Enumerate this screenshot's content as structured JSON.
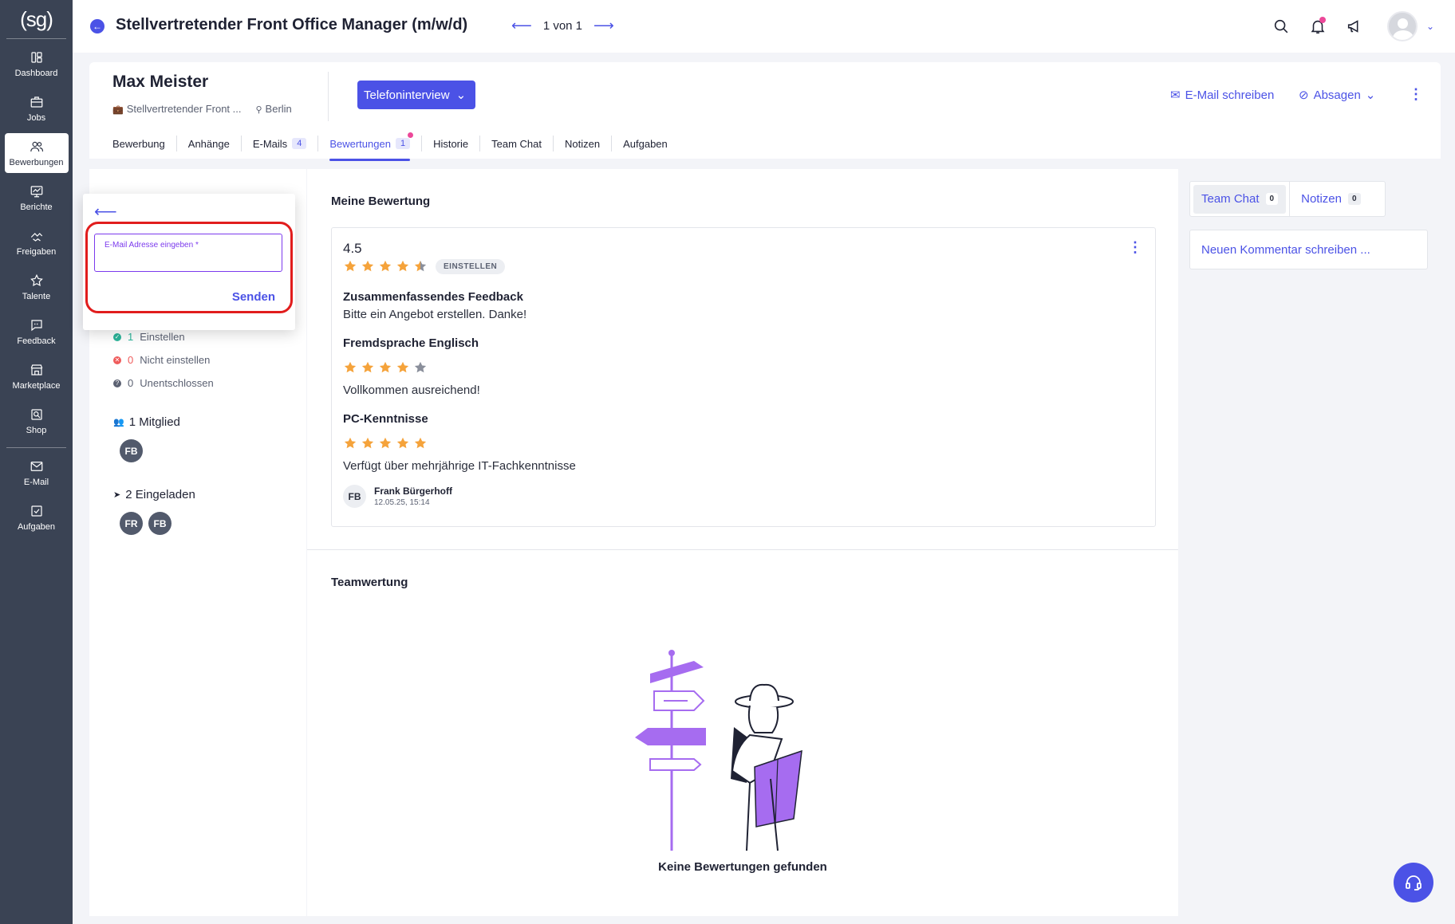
{
  "app": {
    "logo_text": "(sg)"
  },
  "sidebar": {
    "items": [
      {
        "label": "Dashboard",
        "icon": "dashboard-icon"
      },
      {
        "label": "Jobs",
        "icon": "briefcase-icon"
      },
      {
        "label": "Bewerbungen",
        "icon": "users-icon",
        "active": true
      },
      {
        "label": "Berichte",
        "icon": "chart-icon"
      },
      {
        "label": "Freigaben",
        "icon": "handshake-icon"
      },
      {
        "label": "Talente",
        "icon": "star-icon"
      },
      {
        "label": "Feedback",
        "icon": "feedback-icon"
      },
      {
        "label": "Marketplace",
        "icon": "store-icon"
      },
      {
        "label": "Shop",
        "icon": "shop-icon"
      },
      {
        "label": "E-Mail",
        "icon": "mail-icon"
      },
      {
        "label": "Aufgaben",
        "icon": "task-icon"
      }
    ]
  },
  "header": {
    "job_title": "Stellvertretender Front Office Manager (m/w/d)",
    "pager_text": "1 von 1"
  },
  "candidate": {
    "name": "Max Meister",
    "job_short": "Stellvertretender Front ...",
    "location": "Berlin",
    "stage_label": "Telefoninterview",
    "email_action": "E-Mail schreiben",
    "reject_action": "Absagen"
  },
  "tabs": [
    {
      "label": "Bewerbung"
    },
    {
      "label": "Anhänge"
    },
    {
      "label": "E-Mails",
      "badge": "4"
    },
    {
      "label": "Bewertungen",
      "badge": "1",
      "active": true
    },
    {
      "label": "Historie"
    },
    {
      "label": "Team Chat"
    },
    {
      "label": "Notizen"
    },
    {
      "label": "Aufgaben"
    }
  ],
  "summary": {
    "einstellen_count": "1",
    "einstellen_label": "Einstellen",
    "nicht_count": "0",
    "nicht_label": "Nicht einstellen",
    "unent_count": "0",
    "unent_label": "Unentschlossen",
    "members_label": "1 Mitglied",
    "members": [
      "FB"
    ],
    "invited_label": "2 Eingeladen",
    "invited": [
      "FR",
      "FB"
    ]
  },
  "popup": {
    "email_label": "E-Mail Adresse eingeben *",
    "email_value": "",
    "send_label": "Senden"
  },
  "rating": {
    "section_title": "Meine Bewertung",
    "score": "4.5",
    "score_value": 4.5,
    "badge": "EINSTELLEN",
    "summary_title": "Zusammenfassendes Feedback",
    "summary_text": "Bitte ein Angebot erstellen. Danke!",
    "criteria": [
      {
        "title": "Fremdsprache Englisch",
        "stars": 4,
        "text": "Vollkommen ausreichend!"
      },
      {
        "title": "PC-Kenntnisse",
        "stars": 5,
        "text": "Verfügt über mehrjährige IT-Fachkenntnisse"
      }
    ],
    "author_initials": "FB",
    "author_name": "Frank Bürgerhoff",
    "author_date": "12.05.25, 15:14",
    "star_color": "#f5a33b",
    "star_empty_color": "#8a8f9b"
  },
  "team": {
    "section_title": "Teamwertung",
    "empty_message": "Keine Bewertungen gefunden"
  },
  "right": {
    "tab_chat": "Team Chat",
    "tab_chat_count": "0",
    "tab_notes": "Notizen",
    "tab_notes_count": "0",
    "comment_placeholder": "Neuen Kommentar schreiben ..."
  },
  "colors": {
    "accent": "#4b52e6",
    "sidebar": "#3a4354",
    "highlight": "#e11d1d"
  }
}
